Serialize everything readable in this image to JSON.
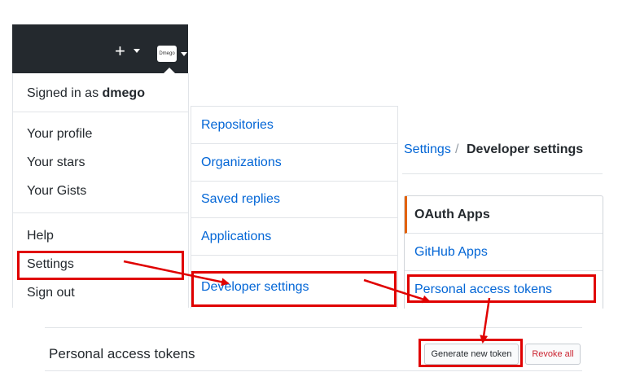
{
  "header": {
    "plus_label": "+",
    "avatar_text": "Dmego"
  },
  "user_menu": {
    "signed_in_prefix": "Signed in as",
    "username": "dmego",
    "items_group1": [
      "Your profile",
      "Your stars",
      "Your Gists"
    ],
    "items_group2": [
      "Help",
      "Settings",
      "Sign out"
    ]
  },
  "settings_nav": {
    "items": [
      "Repositories",
      "Organizations",
      "Saved replies",
      "Applications",
      "Developer settings"
    ]
  },
  "breadcrumb": {
    "settings": "Settings",
    "separator": "/",
    "current": "Developer settings"
  },
  "developer_nav": {
    "items": [
      "OAuth Apps",
      "GitHub Apps",
      "Personal access tokens"
    ],
    "active_index": 0
  },
  "tokens": {
    "title": "Personal access tokens",
    "generate_label": "Generate new token",
    "revoke_label": "Revoke all"
  },
  "colors": {
    "highlight": "#e00000",
    "link": "#0366d6",
    "header_bg": "#24292e",
    "active_accent": "#e36209"
  }
}
